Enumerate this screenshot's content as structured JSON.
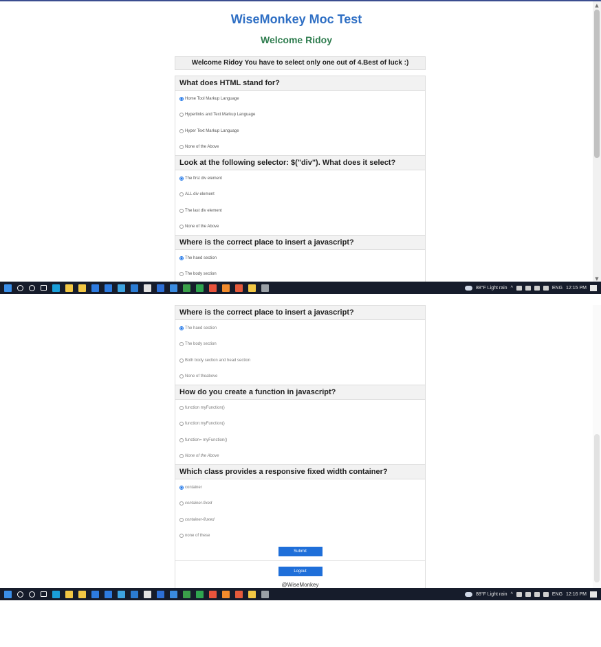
{
  "app": {
    "title": "WiseMonkey Moc Test",
    "welcome": "Welcome Ridoy",
    "instruction": "Welcome Ridoy You have to select only one out of 4.Best of luck :)",
    "submit_label": "Submit",
    "logout_label": "Logout",
    "footer": "@WiseMonkey"
  },
  "screen1": {
    "questions": [
      {
        "question": "What does HTML stand for?",
        "options": [
          "Home Tool Markup Language",
          "Hyperlinks and Text Markup Language",
          "Hyper Text Markup Language",
          "None of the Above"
        ],
        "selected": 0
      },
      {
        "question": "Look at the following selector: $(\"div\"). What does it select?",
        "options": [
          "The first div element",
          "ALL div element",
          "The last div element",
          "None of the Above"
        ],
        "selected": 0
      },
      {
        "question": "Where is the correct place to insert a javascript?",
        "options": [
          "The haed section",
          "The body section"
        ],
        "selected": 0
      }
    ]
  },
  "screen2": {
    "questions": [
      {
        "question": "Where is the correct place to insert a javascript?",
        "options": [
          "The haed section",
          "The body section",
          "Both body section and head section",
          "None of theabove"
        ],
        "selected": 0
      },
      {
        "question": "How do you create a function in javascript?",
        "options": [
          "function myFunction()",
          "function:myFunction()",
          "function= myFunction()",
          "None of the Above"
        ],
        "selected": -1
      },
      {
        "question": "Which class provides a responsive fixed width container?",
        "options": [
          "container",
          "container-fixed",
          "container-fluxed",
          "none of these"
        ],
        "selected": 0
      }
    ]
  },
  "taskbar1": {
    "weather": "88°F  Light rain",
    "lang": "ENG",
    "time": "12:15 PM"
  },
  "taskbar2": {
    "weather": "88°F  Light rain",
    "lang": "ENG",
    "time": "12:16 PM"
  },
  "colors": {
    "title": "#2f6fc4",
    "welcome": "#2f7d4f",
    "button": "#1f6fd9",
    "taskbar": "#161c2b"
  },
  "taskbar_icons": [
    "windows-icon",
    "search-icon",
    "cortana-icon",
    "task-view-icon",
    "edge-icon",
    "file-explorer-icon",
    "store-icon",
    "mail-icon",
    "app-icon",
    "chrome-icon",
    "vscode-icon",
    "app-icon",
    "app-icon",
    "app-icon",
    "app-icon",
    "app-icon",
    "app-icon",
    "app-icon",
    "app-icon",
    "app-icon",
    "terminal-icon"
  ]
}
